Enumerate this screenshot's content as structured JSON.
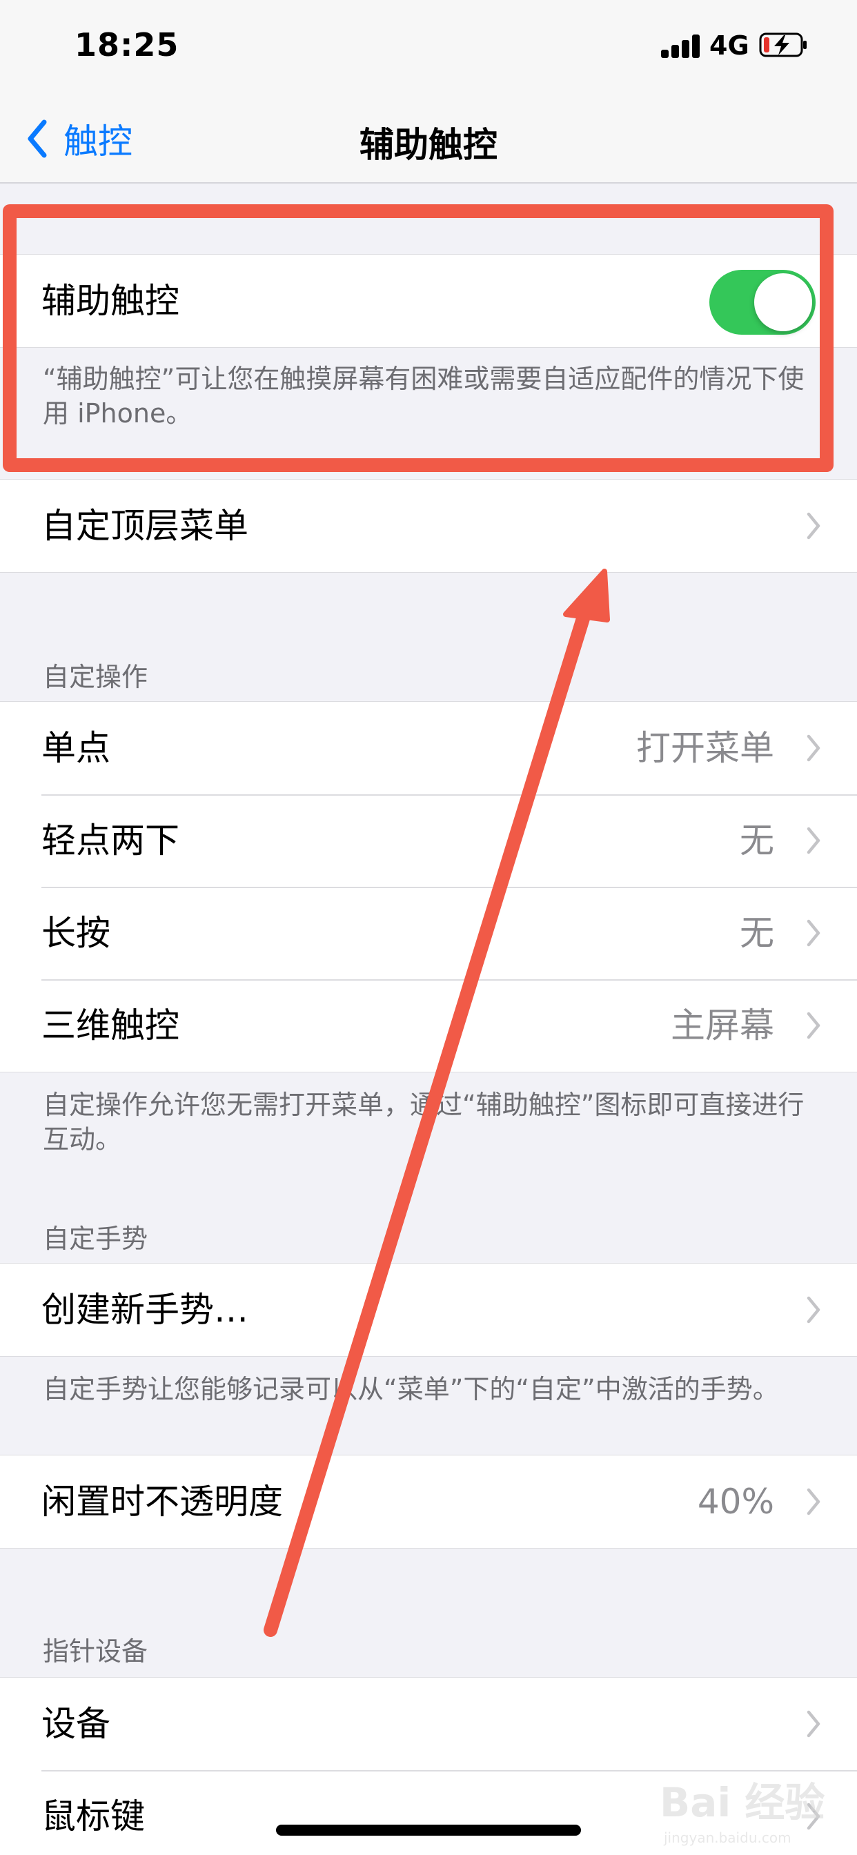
{
  "status_bar": {
    "time": "18:25",
    "network": "4G"
  },
  "nav": {
    "back_label": "触控",
    "title": "辅助触控"
  },
  "assistive_touch": {
    "label": "辅助触控",
    "enabled": true,
    "description": "“辅助触控”可让您在触摸屏幕有困难或需要自适应配件的情况下使用 iPhone。"
  },
  "top_menu": {
    "label": "自定顶层菜单"
  },
  "custom_actions": {
    "header": "自定操作",
    "rows": [
      {
        "label": "单点",
        "value": "打开菜单"
      },
      {
        "label": "轻点两下",
        "value": "无"
      },
      {
        "label": "长按",
        "value": "无"
      },
      {
        "label": "三维触控",
        "value": "主屏幕"
      }
    ],
    "footer": "自定操作允许您无需打开菜单，通过“辅助触控”图标即可直接进行互动。"
  },
  "custom_gestures": {
    "header": "自定手势",
    "create_label": "创建新手势…",
    "footer": "自定手势让您能够记录可以从“菜单”下的“自定”中激活的手势。"
  },
  "idle_opacity": {
    "label": "闲置时不透明度",
    "value": "40%"
  },
  "pointer_devices": {
    "header": "指针设备",
    "rows": [
      {
        "label": "设备"
      },
      {
        "label": "鼠标键"
      }
    ]
  },
  "watermark": {
    "text": "Bai 经验",
    "url": "jingyan.baidu.com"
  },
  "colors": {
    "accent": "#0a7aff",
    "toggle_on": "#34c759",
    "annotation": "#f15a47"
  }
}
